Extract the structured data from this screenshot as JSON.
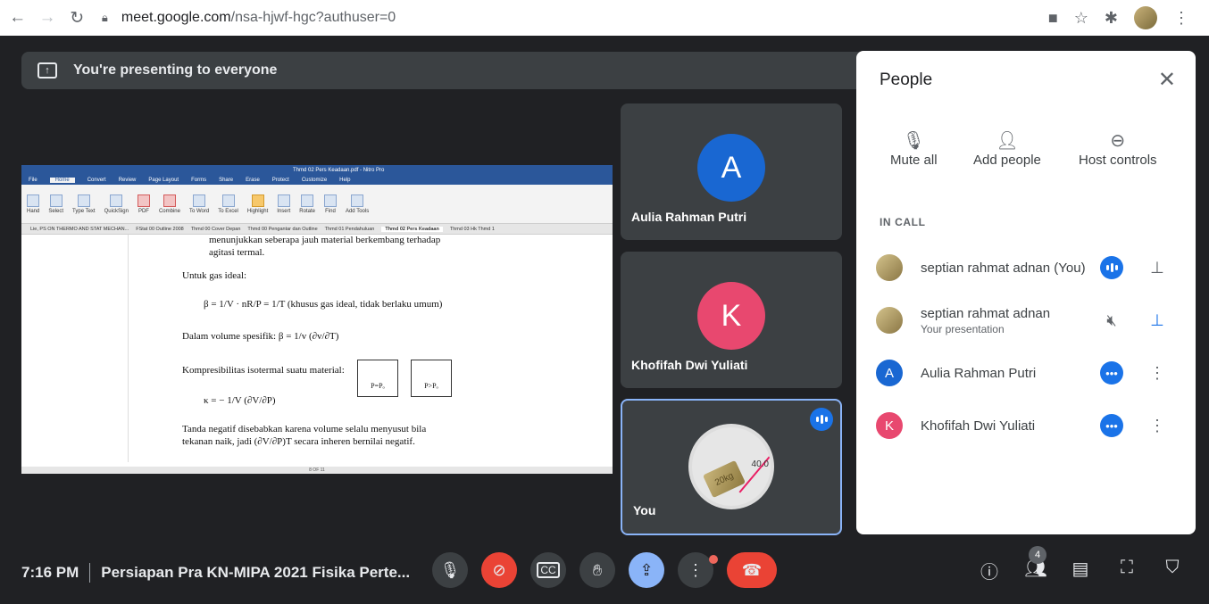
{
  "browser": {
    "back_icon": "arrow-left-icon",
    "url_host": "meet.google.com",
    "url_path": "/nsa-hjwf-hgc?authuser=0"
  },
  "banner": {
    "text": "You're presenting to everyone"
  },
  "presentation": {
    "pdf_title": "Thmd 02 Pers Keadaan.pdf - Nitro Pro",
    "menu": [
      "File",
      "Home",
      "Convert",
      "Review",
      "Page Layout",
      "Forms",
      "Share",
      "Erase",
      "Protect",
      "Customize",
      "Help"
    ],
    "ribbon": [
      "Hand",
      "Select",
      "Type Text",
      "QuickSign",
      "PDF",
      "Combine",
      "To Word",
      "To Excel",
      "Highlight",
      "Insert",
      "Rotate",
      "Find",
      "Add Tools"
    ],
    "tabs": [
      "Lie, PS ON THERMO AND STAT MECHAN...",
      "FStat 00 Outline 2008",
      "Thmd 00 Cover Depan",
      "Thmd 00 Pengantar dan Outline",
      "Thmd 01 Pendahuluan",
      "Thmd 02 Pers Keadaan",
      "Thmd 03 Hk Thmd 1"
    ],
    "lines": {
      "l1": "menunjukkan seberapa jauh material berkembang terhadap",
      "l2": "agitasi termal.",
      "l3": "Untuk gas ideal:",
      "l4": "β = 1/V · nR/P = 1/T   (khusus gas ideal, tidak berlaku umum)",
      "l5": "Dalam volume spesifik:  β = 1/v (∂v/∂T)",
      "l6": "Kompresibilitas isotermal suatu material:",
      "l7": "κ = − 1/V (∂V/∂P)",
      "l8": "Tanda negatif disebabkan karena volume selalu menyusut bila",
      "l9": "tekanan naik, jadi (∂V/∂P)T secara inheren bernilai negatif."
    },
    "piston1": "P=Pₒ",
    "piston2": "P>Pₒ",
    "status": "8 OF 11"
  },
  "tiles": [
    {
      "initial": "A",
      "name": "Aulia Rahman Putri",
      "color": "#1967d2"
    },
    {
      "initial": "K",
      "name": "Khofifah Dwi Yuliati",
      "color": "#e8486f"
    },
    {
      "name": "You",
      "pic_label": "20kg",
      "pic_value": "40.0"
    }
  ],
  "people": {
    "title": "People",
    "actions": [
      {
        "label": "Mute all",
        "icon": "mic-off-icon"
      },
      {
        "label": "Add people",
        "icon": "person-add-icon"
      },
      {
        "label": "Host controls",
        "icon": "toggle-icon"
      }
    ],
    "section": "IN CALL",
    "members": [
      {
        "name": "septian rahmat adnan (You)",
        "sub": ""
      },
      {
        "name": "septian rahmat adnan",
        "sub": "Your presentation"
      },
      {
        "initial": "A",
        "name": "Aulia Rahman Putri",
        "sub": "",
        "color": "#1967d2"
      },
      {
        "initial": "K",
        "name": "Khofifah Dwi Yuliati",
        "sub": "",
        "color": "#e8486f"
      }
    ]
  },
  "bottom": {
    "time": "7:16 PM",
    "meeting_title": "Persiapan Pra KN-MIPA 2021 Fisika Perte...",
    "people_count": "4"
  },
  "colors": {
    "accent": "#1a73e8",
    "danger": "#ea4335",
    "present_active": "#8ab4f8"
  }
}
